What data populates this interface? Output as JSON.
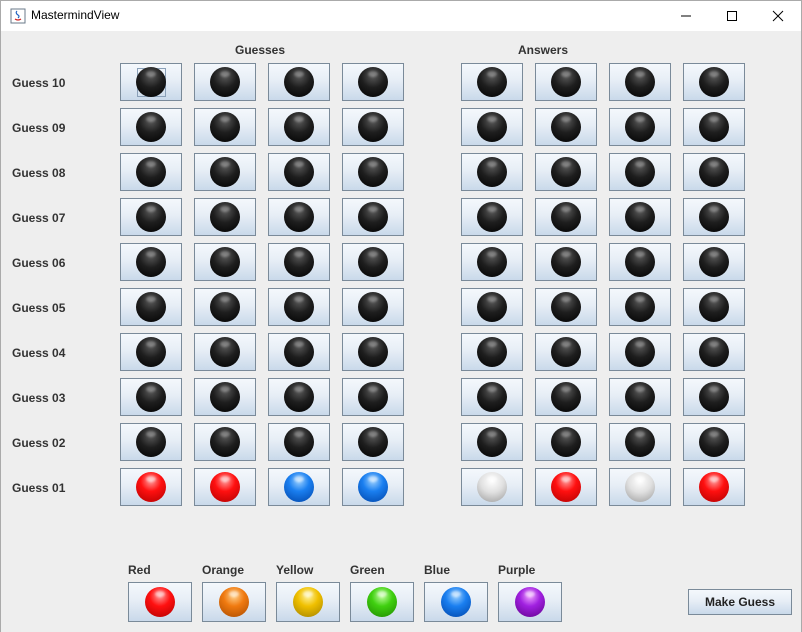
{
  "window": {
    "title": "MastermindView",
    "minimize_glyph": "—",
    "maximize_glyph": "☐",
    "close_glyph": "✕"
  },
  "board": {
    "guesses_header": "Guesses",
    "answers_header": "Answers",
    "rows": [
      {
        "label": "Guess 10",
        "guesses": [
          "black",
          "black",
          "black",
          "black"
        ],
        "answers": [
          "black",
          "black",
          "black",
          "black"
        ]
      },
      {
        "label": "Guess 09",
        "guesses": [
          "black",
          "black",
          "black",
          "black"
        ],
        "answers": [
          "black",
          "black",
          "black",
          "black"
        ]
      },
      {
        "label": "Guess 08",
        "guesses": [
          "black",
          "black",
          "black",
          "black"
        ],
        "answers": [
          "black",
          "black",
          "black",
          "black"
        ]
      },
      {
        "label": "Guess 07",
        "guesses": [
          "black",
          "black",
          "black",
          "black"
        ],
        "answers": [
          "black",
          "black",
          "black",
          "black"
        ]
      },
      {
        "label": "Guess 06",
        "guesses": [
          "black",
          "black",
          "black",
          "black"
        ],
        "answers": [
          "black",
          "black",
          "black",
          "black"
        ]
      },
      {
        "label": "Guess 05",
        "guesses": [
          "black",
          "black",
          "black",
          "black"
        ],
        "answers": [
          "black",
          "black",
          "black",
          "black"
        ]
      },
      {
        "label": "Guess 04",
        "guesses": [
          "black",
          "black",
          "black",
          "black"
        ],
        "answers": [
          "black",
          "black",
          "black",
          "black"
        ]
      },
      {
        "label": "Guess 03",
        "guesses": [
          "black",
          "black",
          "black",
          "black"
        ],
        "answers": [
          "black",
          "black",
          "black",
          "black"
        ]
      },
      {
        "label": "Guess 02",
        "guesses": [
          "black",
          "black",
          "black",
          "black"
        ],
        "answers": [
          "black",
          "black",
          "black",
          "black"
        ]
      },
      {
        "label": "Guess 01",
        "guesses": [
          "red",
          "red",
          "blue",
          "blue"
        ],
        "answers": [
          "white",
          "red",
          "white",
          "red"
        ]
      }
    ]
  },
  "palette": [
    {
      "label": "Red",
      "color": "red"
    },
    {
      "label": "Orange",
      "color": "orange"
    },
    {
      "label": "Yellow",
      "color": "yellow"
    },
    {
      "label": "Green",
      "color": "green"
    },
    {
      "label": "Blue",
      "color": "blue"
    },
    {
      "label": "Purple",
      "color": "purple"
    }
  ],
  "make_guess_label": "Make Guess",
  "colors": {
    "button_border": "#7a8a99",
    "window_bg": "#eeeeee",
    "title_bg": "#ffffff"
  }
}
